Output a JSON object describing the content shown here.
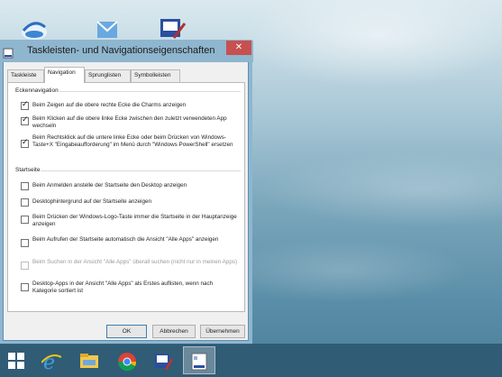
{
  "dialog": {
    "title": "Taskleisten- und Navigationseigenschaften",
    "close_glyph": "✕",
    "tabs": [
      "Taskleiste",
      "Navigation",
      "Sprunglisten",
      "Symbolleisten"
    ],
    "active_tab": "Navigation",
    "groups": {
      "corner": {
        "label": "Eckennavigation",
        "options": [
          {
            "text": "Beim Zeigen auf die obere rechte Ecke die Charms anzeigen",
            "checked": true
          },
          {
            "text": "Beim Klicken auf die obere linke Ecke zwischen den zuletzt verwendeten App wechseln",
            "checked": true
          },
          {
            "text": "Beim Rechtsklick auf die untere linke Ecke oder beim Drücken von Windows-Taste+X \"Eingabeaufforderung\" im Menü durch \"Windows PowerShell\" ersetzen",
            "checked": true
          }
        ]
      },
      "start": {
        "label": "Startseite",
        "options": [
          {
            "text": "Beim Anmelden anstelle der Startseite den Desktop anzeigen",
            "checked": false
          },
          {
            "text": "Desktophintergrund auf der Startseite anzeigen",
            "checked": false
          },
          {
            "text": "Beim Drücken der Windows-Logo-Taste immer die Startseite in der Hauptanzeige anzeigen",
            "checked": false
          },
          {
            "text": "Beim Aufrufen der Startseite automatisch die Ansicht \"Alle Apps\" anzeigen",
            "checked": false
          },
          {
            "text": "Beim Suchen in der Ansicht \"Alle Apps\" überall suchen (nicht nur in meinen Apps)",
            "checked": false,
            "disabled": true
          },
          {
            "text": "Desktop-Apps in der Ansicht \"Alle Apps\" als Erstes auflisten, wenn nach Kategorie sortiert ist",
            "checked": false
          }
        ]
      }
    },
    "buttons": {
      "ok": "OK",
      "cancel": "Abbrechen",
      "apply": "Übernehmen"
    }
  },
  "taskbar": {
    "items": [
      "windows-start-icon",
      "internet-explorer-icon",
      "file-explorer-icon",
      "chrome-icon",
      "taskbar-properties-icon",
      "taskbar-navigation-dialog-icon"
    ]
  },
  "colors": {
    "title_bar": "#8fb6cf",
    "close_button": "#c75050",
    "taskbar": "#2c5670"
  }
}
